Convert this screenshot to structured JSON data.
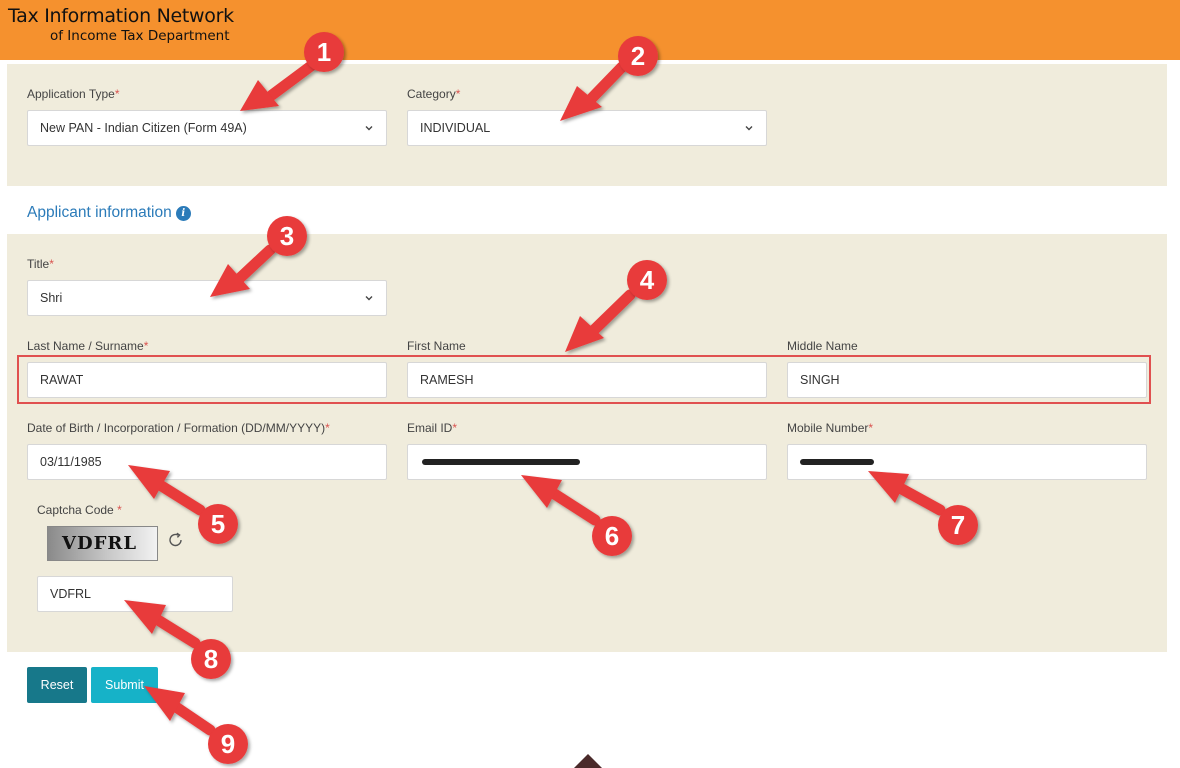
{
  "header": {
    "title_line1": "Tax Information Network",
    "title_line2": "of Income Tax Department"
  },
  "application": {
    "type_label": "Application Type",
    "type_value": "New PAN - Indian Citizen (Form 49A)",
    "category_label": "Category",
    "category_value": "INDIVIDUAL"
  },
  "applicant": {
    "section_title": "Applicant information",
    "info_glyph": "i",
    "title_label": "Title",
    "title_value": "Shri",
    "last_name_label": "Last Name / Surname",
    "last_name_value": "RAWAT",
    "first_name_label": "First Name",
    "first_name_value": "RAMESH",
    "middle_name_label": "Middle Name",
    "middle_name_value": "SINGH",
    "dob_label": "Date of Birth / Incorporation / Formation (DD/MM/YYYY)",
    "dob_value": "03/11/1985",
    "email_label": "Email ID",
    "mobile_label": "Mobile Number"
  },
  "captcha": {
    "label": "Captcha Code",
    "image_text": "VDFRL",
    "input_value": "VDFRL"
  },
  "required_marker": "*",
  "buttons": {
    "reset": "Reset",
    "submit": "Submit"
  },
  "annotations": [
    "1",
    "2",
    "3",
    "4",
    "5",
    "6",
    "7",
    "8",
    "9"
  ],
  "colors": {
    "header": "#f5912e",
    "panel": "#f0ecdc",
    "link_blue": "#2b7bb9",
    "reset_button": "#17788a",
    "submit_button": "#16b2c8",
    "annotation_red": "#e83a3a",
    "highlight_border": "#e05050"
  },
  "icons": [
    "info-icon",
    "chevron-down-icon",
    "refresh-icon",
    "scroll-up-icon",
    "annotation-arrow"
  ]
}
